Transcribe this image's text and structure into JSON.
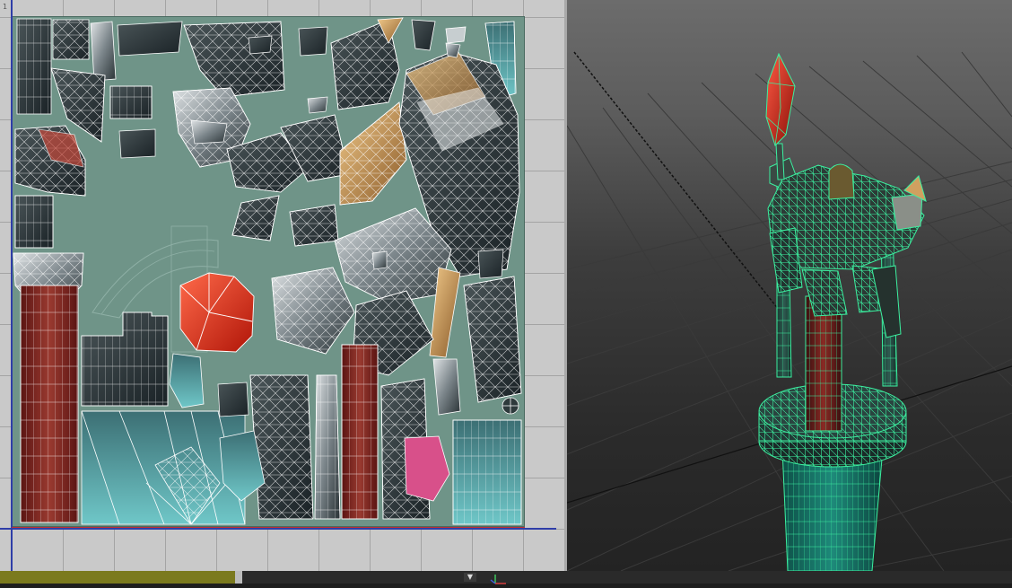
{
  "uv_editor": {
    "corner_label": "1",
    "texture_bg": "#6f9488"
  },
  "status_bar": {
    "dropdown_glyph": "▼"
  },
  "viewport": {
    "wireframe_color": "#3cf0a0",
    "crystal_color": "#d0301f",
    "banner_color": "#7a2420"
  }
}
